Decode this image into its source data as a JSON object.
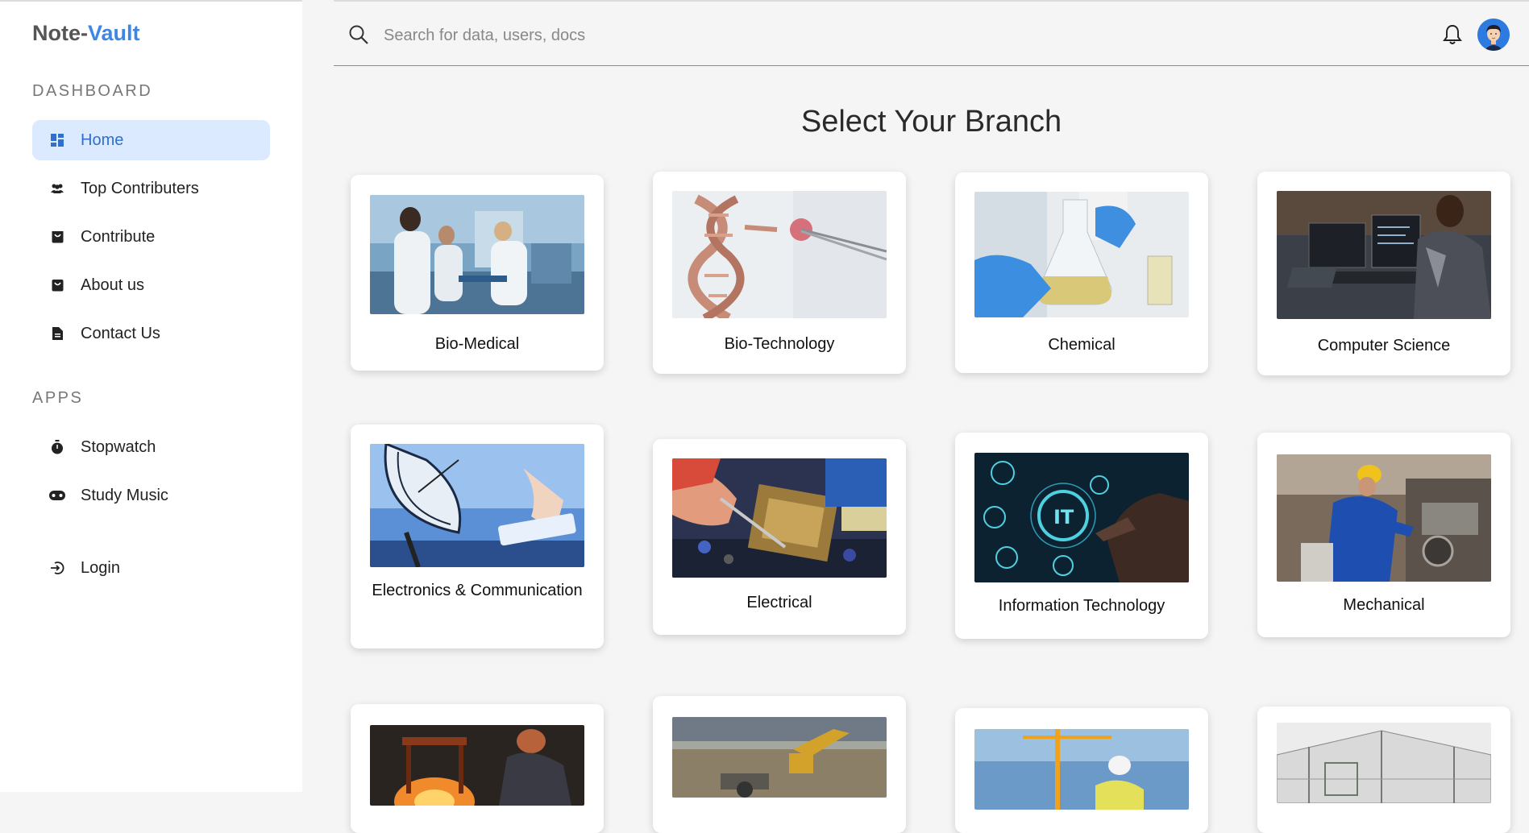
{
  "app": {
    "logo_part1": "Note-",
    "logo_part2": "Vault"
  },
  "sidebar": {
    "dashboard_title": "DASHBOARD",
    "apps_title": "APPS",
    "items": [
      {
        "label": "Home",
        "icon": "grid-icon"
      },
      {
        "label": "Top Contributers",
        "icon": "users-icon"
      },
      {
        "label": "Contribute",
        "icon": "bag-icon"
      },
      {
        "label": "About us",
        "icon": "bag-icon"
      },
      {
        "label": "Contact Us",
        "icon": "document-icon"
      }
    ],
    "apps": [
      {
        "label": "Stopwatch",
        "icon": "stopwatch-icon"
      },
      {
        "label": "Study Music",
        "icon": "gamepad-icon"
      }
    ],
    "login": {
      "label": "Login",
      "icon": "login-icon"
    }
  },
  "search": {
    "placeholder": "Search for data, users, docs",
    "value": ""
  },
  "main": {
    "title": "Select Your Branch",
    "branches": [
      {
        "label": "Bio-Medical"
      },
      {
        "label": "Bio-Technology"
      },
      {
        "label": "Chemical"
      },
      {
        "label": "Computer Science"
      },
      {
        "label": "Electronics & Communication"
      },
      {
        "label": "Electrical"
      },
      {
        "label": "Information Technology"
      },
      {
        "label": "Mechanical"
      }
    ]
  },
  "colors": {
    "accent": "#3d86e6",
    "active_bg": "#dbeafe",
    "page_bg": "#f5f5f5"
  }
}
